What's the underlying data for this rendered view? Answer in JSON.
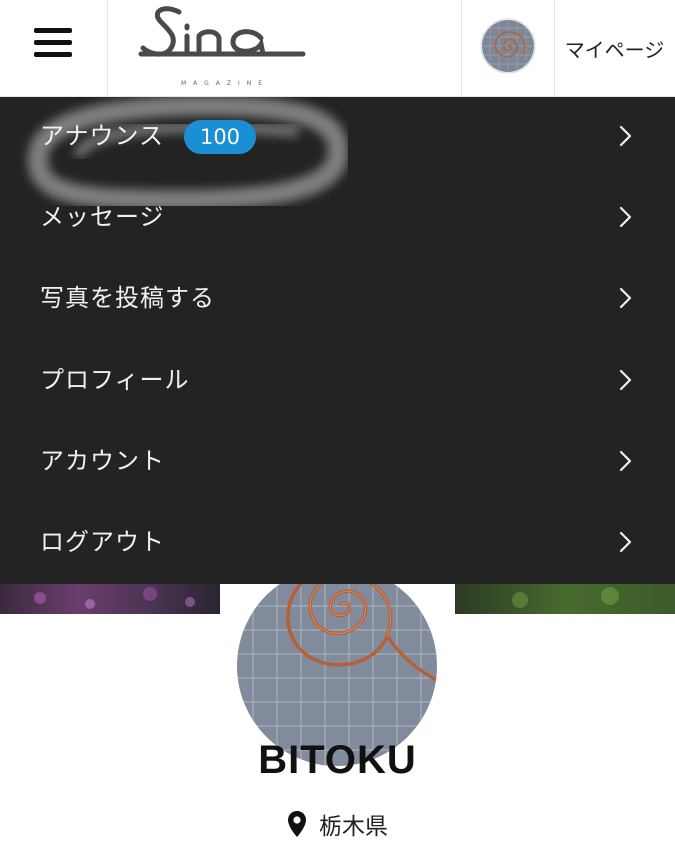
{
  "header": {
    "menu_icon": "hamburger-icon",
    "logo_text": "Sina",
    "logo_subtext": "MAGAZINE",
    "avatar_icon": "user-avatar",
    "mypage_label": "マイページ"
  },
  "menu": {
    "background_color": "#232323",
    "items": [
      {
        "label": "アナウンス",
        "badge": "100",
        "icon": "chevron-right-icon"
      },
      {
        "label": "メッセージ",
        "icon": "chevron-right-icon"
      },
      {
        "label": "写真を投稿する",
        "icon": "chevron-right-icon"
      },
      {
        "label": "プロフィール",
        "icon": "chevron-right-icon"
      },
      {
        "label": "アカウント",
        "icon": "chevron-right-icon"
      },
      {
        "label": "ログアウト",
        "icon": "chevron-right-icon"
      }
    ],
    "badge_color": "#1a8fd3"
  },
  "profile": {
    "username": "BITOKU",
    "location": "栃木県",
    "location_icon": "map-pin-icon"
  }
}
